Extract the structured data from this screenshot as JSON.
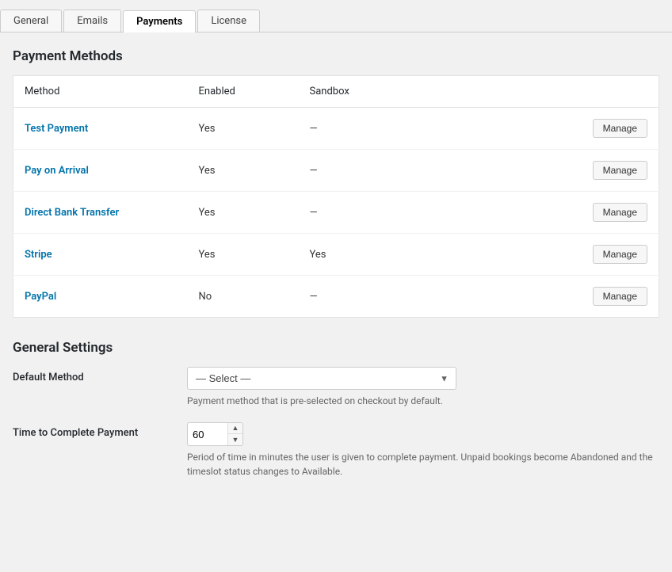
{
  "tabs": [
    {
      "id": "general",
      "label": "General",
      "active": false
    },
    {
      "id": "emails",
      "label": "Emails",
      "active": false
    },
    {
      "id": "payments",
      "label": "Payments",
      "active": true
    },
    {
      "id": "license",
      "label": "License",
      "active": false
    }
  ],
  "payment_methods_section": {
    "title": "Payment Methods",
    "table": {
      "headers": {
        "method": "Method",
        "enabled": "Enabled",
        "sandbox": "Sandbox"
      },
      "rows": [
        {
          "id": "test-payment",
          "method": "Test Payment",
          "enabled": "Yes",
          "sandbox": "—",
          "action": "Manage"
        },
        {
          "id": "pay-on-arrival",
          "method": "Pay on Arrival",
          "enabled": "Yes",
          "sandbox": "—",
          "action": "Manage"
        },
        {
          "id": "direct-bank-transfer",
          "method": "Direct Bank Transfer",
          "enabled": "Yes",
          "sandbox": "—",
          "action": "Manage"
        },
        {
          "id": "stripe",
          "method": "Stripe",
          "enabled": "Yes",
          "sandbox": "Yes",
          "action": "Manage"
        },
        {
          "id": "paypal",
          "method": "PayPal",
          "enabled": "No",
          "sandbox": "—",
          "action": "Manage"
        }
      ]
    }
  },
  "general_settings_section": {
    "title": "General Settings",
    "default_method": {
      "label": "Default Method",
      "select_placeholder": "— Select —",
      "description": "Payment method that is pre-selected on checkout by default.",
      "options": [
        {
          "value": "",
          "label": "— Select —"
        },
        {
          "value": "test-payment",
          "label": "Test Payment"
        },
        {
          "value": "pay-on-arrival",
          "label": "Pay on Arrival"
        },
        {
          "value": "direct-bank-transfer",
          "label": "Direct Bank Transfer"
        },
        {
          "value": "stripe",
          "label": "Stripe"
        },
        {
          "value": "paypal",
          "label": "PayPal"
        }
      ]
    },
    "time_to_complete": {
      "label": "Time to Complete Payment",
      "value": "60",
      "description": "Period of time in minutes the user is given to complete payment. Unpaid bookings become Abandoned and the timeslot status changes to Available."
    }
  }
}
